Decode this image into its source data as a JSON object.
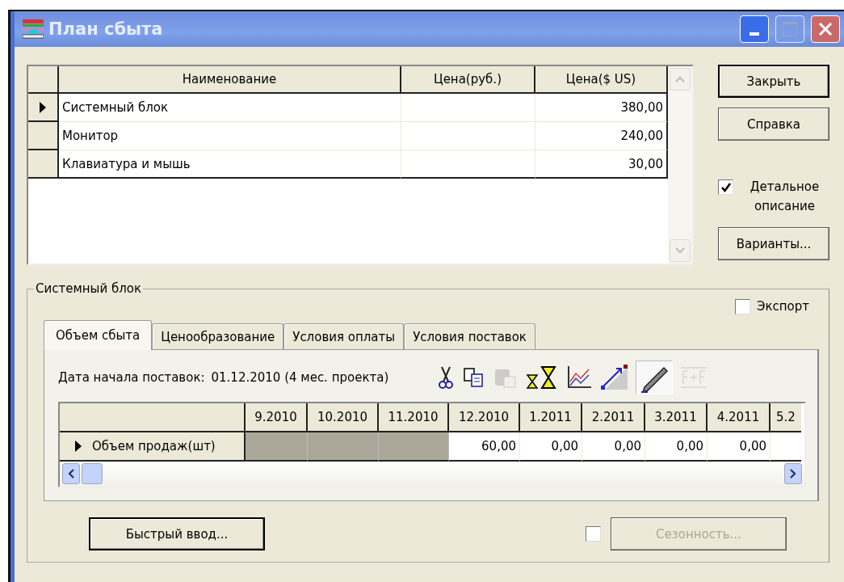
{
  "window": {
    "title": "План сбыта"
  },
  "products": {
    "columns": [
      "Наименование",
      "Цена(руб.)",
      "Цена($ US)"
    ],
    "rows": [
      {
        "name": "Системный блок",
        "price_usd": "380,00",
        "selected": true
      },
      {
        "name": "Монитор",
        "price_usd": "240,00",
        "selected": false
      },
      {
        "name": "Клавиатура и мышь",
        "price_usd": "30,00",
        "selected": false
      }
    ]
  },
  "side_buttons": [
    {
      "label": "Закрыть",
      "default": true
    },
    {
      "label": "Справка",
      "default": false
    }
  ],
  "detail_checkbox": {
    "label": "Детальное описание",
    "checked": true
  },
  "variants_button": {
    "label": "Варианты..."
  },
  "group": {
    "title": "Системный блок"
  },
  "export_checkbox": {
    "label": "Экспорт",
    "checked": false
  },
  "tabs": [
    {
      "label": "Объем сбыта",
      "selected": true
    },
    {
      "label": "Ценообразование",
      "selected": false
    },
    {
      "label": "Условия оплаты",
      "selected": false
    },
    {
      "label": "Условия поставок",
      "selected": false
    }
  ],
  "start_date": {
    "label": "Дата начала поставок:",
    "value": "01.12.2010 (4 мес. проекта)"
  },
  "toolbar": [
    {
      "kind": "cut",
      "disabled": false,
      "pressed": false
    },
    {
      "kind": "copy",
      "disabled": false,
      "pressed": false
    },
    {
      "kind": "paste",
      "disabled": true,
      "pressed": false
    },
    {
      "kind": "hourglass",
      "disabled": false,
      "pressed": false
    },
    {
      "kind": "chart",
      "disabled": false,
      "pressed": false
    },
    {
      "kind": "trend",
      "disabled": false,
      "pressed": false
    },
    {
      "kind": "pencil",
      "disabled": false,
      "pressed": true
    },
    {
      "kind": "formula",
      "disabled": true,
      "pressed": false
    }
  ],
  "plan": {
    "columns": [
      "9.2010",
      "10.2010",
      "11.2010",
      "12.2010",
      "1.2011",
      "2.2011",
      "3.2011",
      "4.2011",
      "5.2"
    ],
    "row": {
      "label": "Объем продаж(шт)",
      "selected": true,
      "cells": [
        {
          "inactive": true
        },
        {
          "inactive": true
        },
        {
          "inactive": true
        },
        {
          "value": "60,00",
          "inactive": false
        },
        {
          "value": "0,00",
          "inactive": false
        },
        {
          "value": "0,00",
          "inactive": false
        },
        {
          "value": "0,00",
          "inactive": false
        },
        {
          "value": "0,00",
          "inactive": false
        }
      ]
    }
  },
  "quick_input_button": {
    "label": "Быстрый ввод..."
  },
  "seasonality": {
    "checked": false,
    "label": "Сезонность...",
    "disabled": true
  }
}
